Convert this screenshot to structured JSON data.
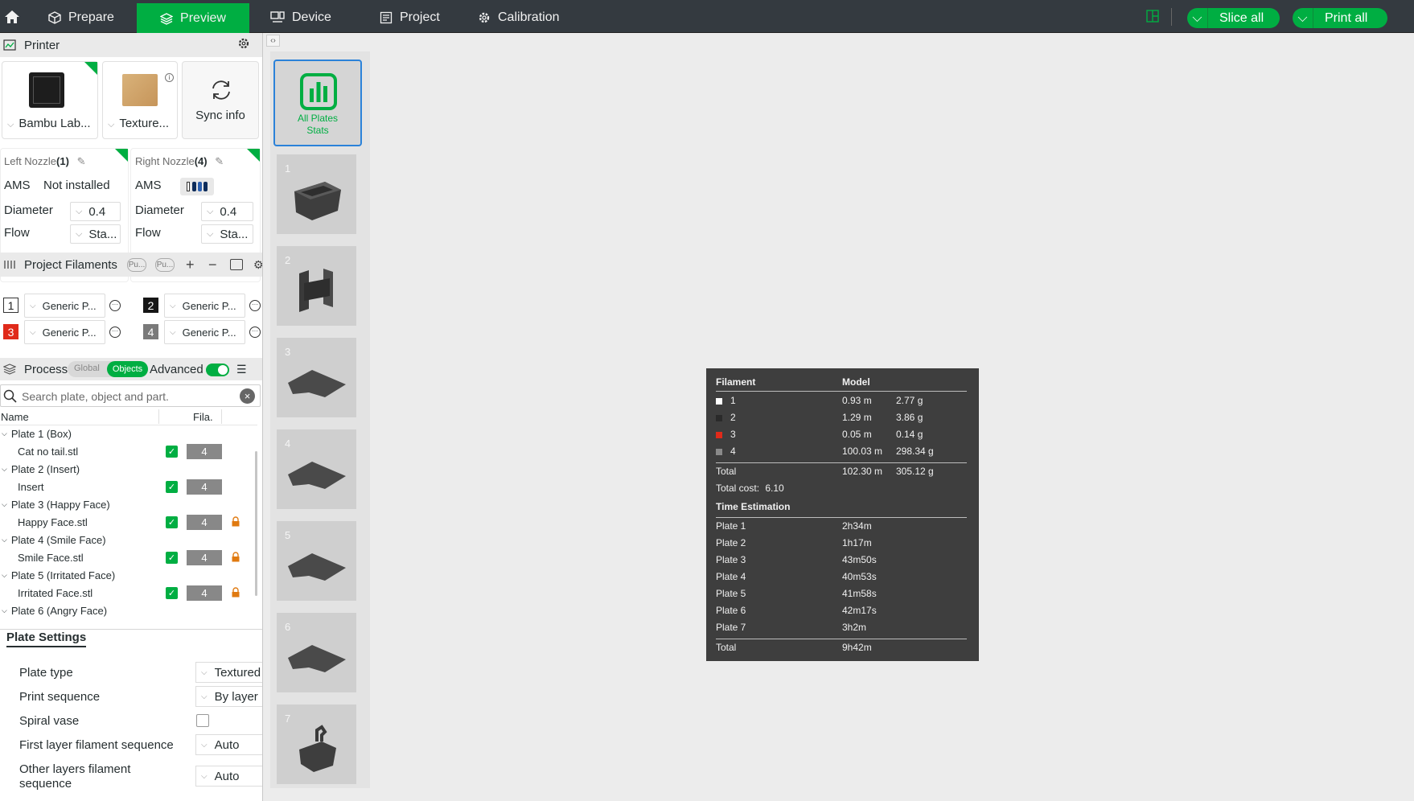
{
  "topbar": {
    "tabs": [
      {
        "label": "Prepare"
      },
      {
        "label": "Preview"
      },
      {
        "label": "Device"
      },
      {
        "label": "Project"
      },
      {
        "label": "Calibration"
      }
    ],
    "slice_all_label": "Slice all",
    "print_all_label": "Print all"
  },
  "printer": {
    "section_title": "Printer",
    "printer_name": "Bambu Lab...",
    "plate_name": "Texture...",
    "sync_label": "Sync info",
    "left_nozzle": {
      "title": "Left Nozzle",
      "index": "(1)",
      "ams_label": "AMS",
      "ams_value": "Not installed",
      "diameter_label": "Diameter",
      "diameter_value": "0.4",
      "flow_label": "Flow",
      "flow_value": "Sta..."
    },
    "right_nozzle": {
      "title": "Right Nozzle",
      "index": "(4)",
      "ams_label": "AMS",
      "diameter_label": "Diameter",
      "diameter_value": "0.4",
      "flow_label": "Flow",
      "flow_value": "Sta..."
    }
  },
  "filaments": {
    "section_title": "Project Filaments",
    "pill1": "Pu...",
    "pill2": "Pu...",
    "items": [
      {
        "num": "1",
        "name": "Generic P...",
        "color": "#ffffff"
      },
      {
        "num": "2",
        "name": "Generic P...",
        "color": "#161616"
      },
      {
        "num": "3",
        "name": "Generic P...",
        "color": "#e02a1a"
      },
      {
        "num": "4",
        "name": "Generic P...",
        "color": "#7a7a7a"
      }
    ]
  },
  "process": {
    "section_title": "Process",
    "toggle_global": "Global",
    "toggle_objects": "Objects",
    "advanced_label": "Advanced",
    "search_placeholder": "Search plate, object and part.",
    "col_name": "Name",
    "col_fila": "Fila.",
    "tree": [
      {
        "label": "Plate 1 (Box)"
      },
      {
        "label": "Cat no tail.stl",
        "fila": "4"
      },
      {
        "label": "Plate 2 (Insert)"
      },
      {
        "label": "Insert",
        "fila": "4"
      },
      {
        "label": "Plate 3 (Happy Face)"
      },
      {
        "label": "Happy Face.stl",
        "fila": "4"
      },
      {
        "label": "Plate 4 (Smile Face)"
      },
      {
        "label": "Smile Face.stl",
        "fila": "4"
      },
      {
        "label": "Plate 5 (Irritated Face)"
      },
      {
        "label": "Irritated Face.stl",
        "fila": "4"
      },
      {
        "label": "Plate 6 (Angry Face)"
      }
    ]
  },
  "plate_settings": {
    "tab_label": "Plate Settings",
    "plate_type_label": "Plate type",
    "plate_type_value": "Textured",
    "print_sequence_label": "Print sequence",
    "print_sequence_value": "By layer",
    "spiral_vase_label": "Spiral vase",
    "first_layer_label": "First layer filament sequence",
    "first_layer_value": "Auto",
    "other_layers_label_1": "Other layers filament",
    "other_layers_label_2": "sequence",
    "other_layers_value": "Auto"
  },
  "plates_panel": {
    "all_stats_line1": "All Plates",
    "all_stats_line2": "Stats",
    "plates": [
      {
        "num": "1"
      },
      {
        "num": "2"
      },
      {
        "num": "3"
      },
      {
        "num": "4"
      },
      {
        "num": "5"
      },
      {
        "num": "6"
      },
      {
        "num": "7"
      }
    ]
  },
  "stats": {
    "col_filament": "Filament",
    "col_model": "Model",
    "filament_rows": [
      {
        "id": "1",
        "length": "0.93 m",
        "weight": "2.77 g",
        "color": "#ffffff"
      },
      {
        "id": "2",
        "length": "1.29 m",
        "weight": "3.86 g",
        "color": "#2a2a2a"
      },
      {
        "id": "3",
        "length": "0.05 m",
        "weight": "0.14 g",
        "color": "#e02a1a"
      },
      {
        "id": "4",
        "length": "100.03 m",
        "weight": "298.34 g",
        "color": "#8a8a8a"
      }
    ],
    "total_label": "Total",
    "total_length": "102.30 m",
    "total_weight": "305.12 g",
    "total_cost_label": "Total cost:",
    "total_cost_value": "6.10",
    "time_heading": "Time Estimation",
    "time_rows": [
      {
        "plate": "Plate 1",
        "time": "2h34m"
      },
      {
        "plate": "Plate 2",
        "time": "1h17m"
      },
      {
        "plate": "Plate 3",
        "time": "43m50s"
      },
      {
        "plate": "Plate 4",
        "time": "40m53s"
      },
      {
        "plate": "Plate 5",
        "time": "41m58s"
      },
      {
        "plate": "Plate 6",
        "time": "42m17s"
      },
      {
        "plate": "Plate 7",
        "time": "3h2m"
      }
    ],
    "time_total_label": "Total",
    "time_total_value": "9h42m"
  }
}
